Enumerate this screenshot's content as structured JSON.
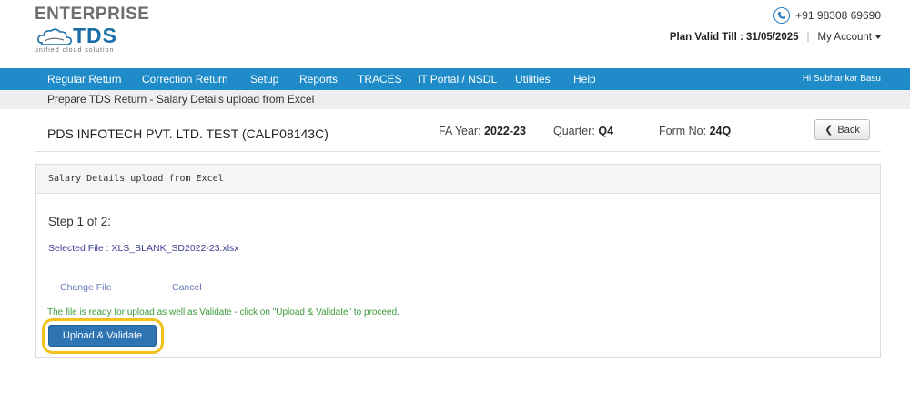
{
  "brand": {
    "name_top": "ENTERPRISE",
    "name_main": "TDS",
    "tagline": "unified cloud solution",
    "primary_color": "#1f8cc9"
  },
  "header": {
    "phone_icon": "phone-icon",
    "phone": "+91 98308 69690",
    "plan_valid": "Plan Valid Till : 31/05/2025",
    "separator": "|",
    "my_account": "My Account"
  },
  "nav": {
    "items": [
      "Regular Return",
      "Correction Return",
      "Setup",
      "Reports",
      "TRACES",
      "IT Portal / NSDL",
      "Utilities",
      "Help"
    ],
    "greeting": "Hi Subhankar Basu"
  },
  "breadcrumb": "Prepare TDS Return - Salary Details upload from Excel",
  "title_row": {
    "company": "PDS INFOTECH PVT. LTD. TEST (CALP08143C)",
    "fa_year_label": "FA Year:",
    "fa_year_value": "2022-23",
    "quarter_label": "Quarter:",
    "quarter_value": "Q4",
    "form_label": "Form No:",
    "form_value": "24Q",
    "back_label": "Back"
  },
  "panel": {
    "title": "Salary Details upload from Excel",
    "step": "Step 1 of 2:",
    "selected_file": "Selected File : XLS_BLANK_SD2022-23.xlsx",
    "change_file": "Change File",
    "cancel": "Cancel",
    "ready_message": "The file is ready for upload as well as Validate - click on \"Upload & Validate\" to proceed.",
    "upload_button": "Upload & Validate",
    "highlight_color": "#f2c21b"
  }
}
